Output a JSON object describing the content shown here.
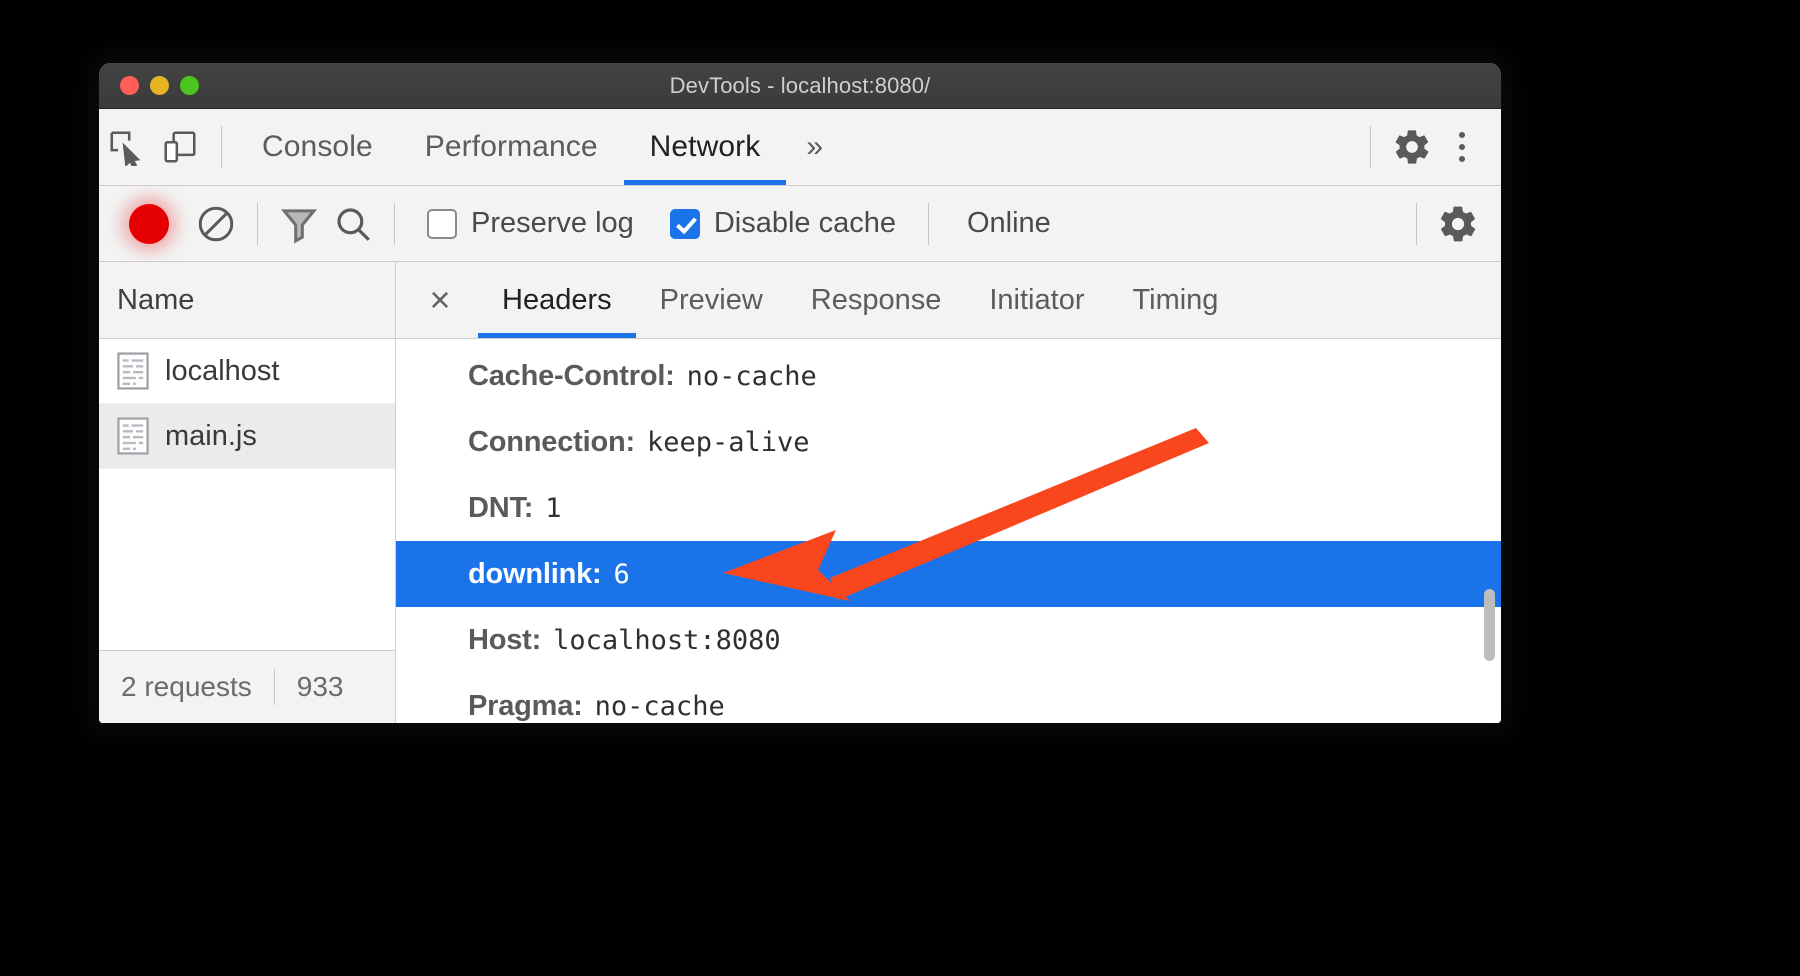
{
  "window": {
    "title": "DevTools - localhost:8080/",
    "traffic_lights": [
      "close",
      "minimize",
      "zoom"
    ]
  },
  "panel_tabs": {
    "icons": [
      "inspect-element-icon",
      "device-toolbar-icon"
    ],
    "items": [
      {
        "label": "Console",
        "active": false
      },
      {
        "label": "Performance",
        "active": false
      },
      {
        "label": "Network",
        "active": true
      }
    ],
    "overflow_label": "»",
    "right_icons": [
      "settings-gear-icon",
      "more-options-icon"
    ],
    "accent_color": "#1a73e8"
  },
  "network_toolbar": {
    "record_label": "record",
    "record_color": "#e40000",
    "clear_label": "clear",
    "filter_label": "filter",
    "search_label": "search",
    "preserve_log": {
      "label": "Preserve log",
      "checked": false
    },
    "disable_cache": {
      "label": "Disable cache",
      "checked": true
    },
    "throttling": "Online",
    "settings_label": "settings"
  },
  "sidebar": {
    "column_header": "Name",
    "rows": [
      {
        "name": "localhost",
        "selected": false
      },
      {
        "name": "main.js",
        "selected": true
      }
    ],
    "footer": {
      "requests": "2 requests",
      "transferred": "933"
    }
  },
  "detail": {
    "close_label": "×",
    "tabs": [
      {
        "label": "Headers",
        "active": true
      },
      {
        "label": "Preview",
        "active": false
      },
      {
        "label": "Response",
        "active": false
      },
      {
        "label": "Initiator",
        "active": false
      },
      {
        "label": "Timing",
        "active": false
      }
    ],
    "headers": [
      {
        "name": "Cache-Control:",
        "value": "no-cache",
        "selected": false
      },
      {
        "name": "Connection:",
        "value": "keep-alive",
        "selected": false
      },
      {
        "name": "DNT:",
        "value": "1",
        "selected": false
      },
      {
        "name": "downlink:",
        "value": "6",
        "selected": true
      },
      {
        "name": "Host:",
        "value": "localhost:8080",
        "selected": false
      },
      {
        "name": "Pragma:",
        "value": "no-cache",
        "selected": false
      }
    ],
    "selected_row_color": "#1a73e8"
  },
  "annotation": {
    "type": "arrow",
    "color": "#f9461c",
    "points_to": "downlink-header-row"
  }
}
